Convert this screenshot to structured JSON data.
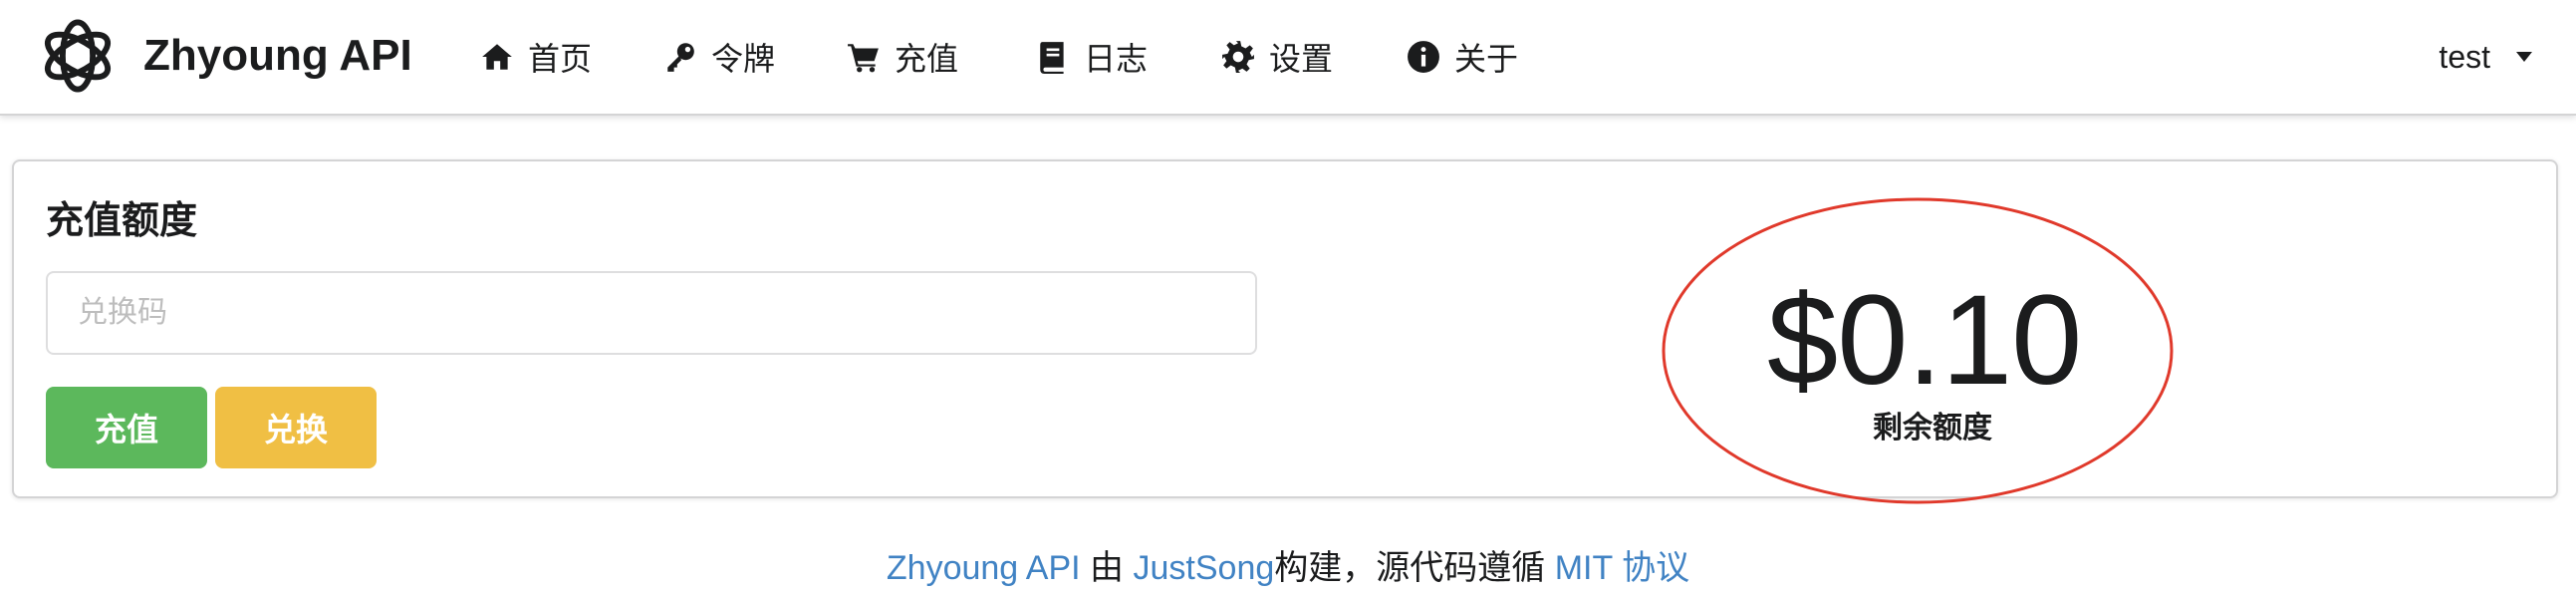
{
  "navbar": {
    "brand": "Zhyoung API",
    "items": [
      {
        "label": "首页",
        "icon": "home-icon"
      },
      {
        "label": "令牌",
        "icon": "key-icon"
      },
      {
        "label": "充值",
        "icon": "cart-icon"
      },
      {
        "label": "日志",
        "icon": "book-icon"
      },
      {
        "label": "设置",
        "icon": "gear-icon"
      },
      {
        "label": "关于",
        "icon": "info-icon"
      }
    ],
    "user": "test"
  },
  "topup": {
    "title": "充值额度",
    "redeem_placeholder": "兑换码",
    "redeem_value": "",
    "topup_button": "充值",
    "redeem_button": "兑换",
    "balance": "$0.10",
    "balance_label": "剩余额度"
  },
  "footer": {
    "project": "Zhyoung API",
    "by": "由",
    "author": "JustSong",
    "built": "构建，源代码遵循",
    "license": "MIT 协议"
  },
  "colors": {
    "topup_button": "#5cb85c",
    "redeem_button": "#f0bf44",
    "link": "#4183c4",
    "highlight_oval": "#e0392b"
  }
}
